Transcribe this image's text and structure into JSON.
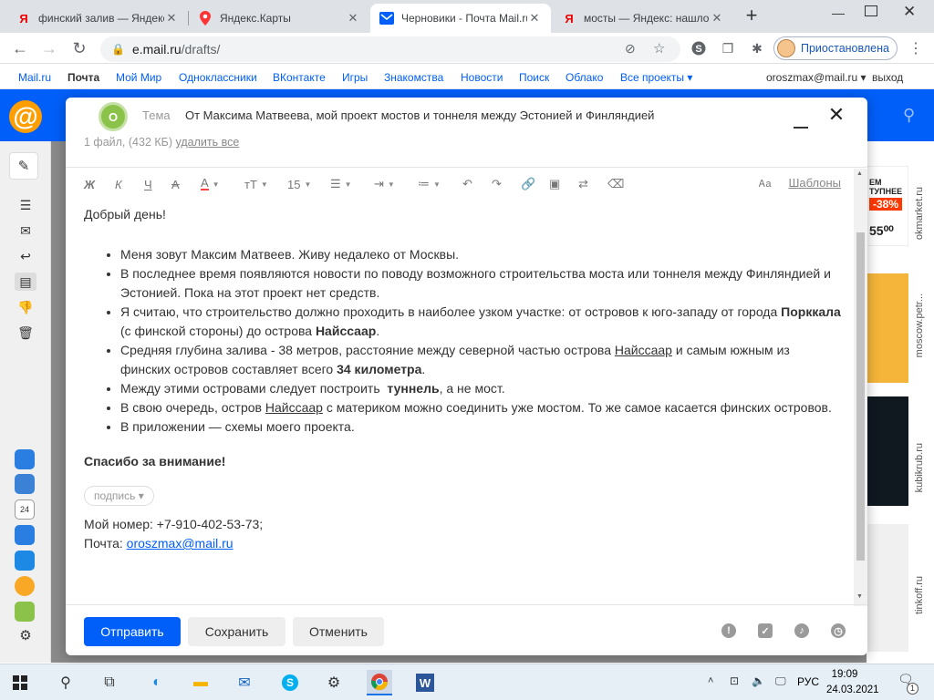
{
  "browser": {
    "tabs": [
      {
        "favicon": "Я",
        "title": "финский залив — Яндекс"
      },
      {
        "favicon": "map-pin",
        "title": "Яндекс.Карты"
      },
      {
        "favicon": "mail",
        "title": "Черновики - Почта Mail.ru"
      },
      {
        "favicon": "Я",
        "title": "мосты — Яндекс: нашлось"
      }
    ],
    "url_host": "e.mail.ru",
    "url_path": "/drafts/",
    "profile_label": "Приостановлена"
  },
  "portal_nav": {
    "items": [
      "Mail.ru",
      "Почта",
      "Мой Мир",
      "Одноклассники",
      "ВКонтакте",
      "Игры",
      "Знакомства",
      "Новости",
      "Поиск",
      "Облако",
      "Все проекты ▾"
    ],
    "user": "oroszmax@mail.ru ▾",
    "logout": "выход"
  },
  "compose": {
    "avatar_letter": "О",
    "subject_label": "Тема",
    "subject": "От Максима Матвеева, мой проект мостов и тоннеля между Эстонией и Финляндией",
    "attach_info": "1 файл, (432 КБ) ",
    "attach_delete": "удалить все",
    "toolbar": {
      "font_size": "15",
      "templates": "Шаблоны"
    },
    "greeting": "Добрый день!",
    "bullets": {
      "b1": "Меня зовут Максим Матвеев. Живу недалеко от Москвы.",
      "b2": "В последнее время появляются новости по поводу возможного строительства моста или тоннеля между Финляндией и Эстонией. Пока на этот проект нет средств.",
      "b3a": "Я считаю, что строительство должно проходить в наиболее узком участке: от островов к юго-западу от города ",
      "b3b": "Порккала",
      "b3c": " (с финской стороны) до острова ",
      "b3d": "Найссаар",
      "b3e": ".",
      "b4a": "Средняя глубина залива - 38 метров, расстояние между северной частью острова ",
      "b4b": "Найссаар",
      "b4c": " и самым южным из финских островов составляет всего ",
      "b4d": "34 километра",
      "b4e": ".",
      "b5a": "Между этими островами следует построить  ",
      "b5b": "туннель",
      "b5c": ", а не мост.",
      "b6a": "В свою очередь, остров ",
      "b6b": "Найссаар",
      "b6c": " с материком можно соединить уже мостом. То же самое касается финских островов.",
      "b7": "В приложении — схемы моего проекта."
    },
    "thanks": "Спасибо за внимание!",
    "signature_tag": "подпись ▾",
    "phone_line": "Мой номер: +7-910-402-53-73;",
    "mail_label": "Почта: ",
    "mail_link": "oroszmax@mail.ru",
    "buttons": {
      "send": "Отправить",
      "save": "Сохранить",
      "cancel": "Отменить"
    }
  },
  "ads": {
    "labels": [
      "okmarket.ru",
      "moscow.petr...",
      "kubikrub.ru",
      "tinkoff.ru"
    ],
    "promo_top": "ЕМ\nТУПНЕЕ",
    "promo_discount": "-38%",
    "promo_price": "55⁰⁰"
  },
  "taskbar": {
    "lang": "РУС",
    "time": "19:09",
    "date": "24.03.2021",
    "notif_count": "1"
  },
  "colors": {
    "brand_blue": "#005ff9",
    "accent_orange": "#ff9e00",
    "avatar_green": "#8bc34a"
  }
}
